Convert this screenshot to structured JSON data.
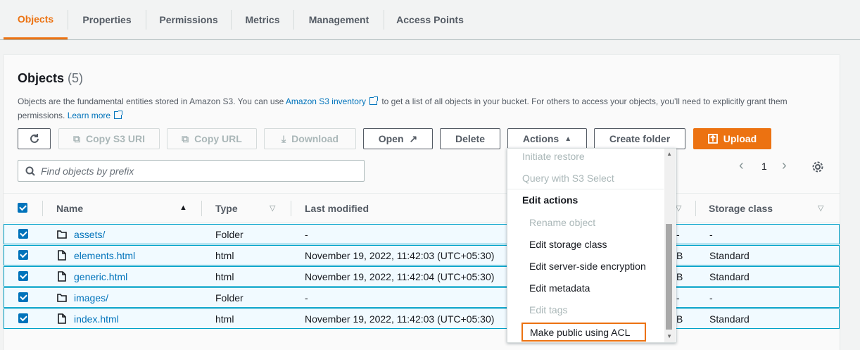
{
  "tabs": [
    "Objects",
    "Properties",
    "Permissions",
    "Metrics",
    "Management",
    "Access Points"
  ],
  "objects_panel": {
    "title": "Objects",
    "count": "(5)",
    "description_part1": "Objects are the fundamental entities stored in Amazon S3. You can use",
    "inventory_link": "Amazon S3 inventory",
    "description_part2": "to get a list of all objects in your bucket. For others to access your objects, you’ll need to explicitly grant them permissions.",
    "learn_more": "Learn more"
  },
  "toolbar": {
    "copy_s3_uri": "Copy S3 URI",
    "copy_url": "Copy URL",
    "download": "Download",
    "open": "Open",
    "delete": "Delete",
    "actions": "Actions",
    "create_folder": "Create folder",
    "upload": "Upload"
  },
  "search": {
    "placeholder": "Find objects by prefix"
  },
  "pagination": {
    "page": "1"
  },
  "table": {
    "headers": {
      "name": "Name",
      "type": "Type",
      "last_modified": "Last modified",
      "storage_class": "Storage class"
    },
    "rows": [
      {
        "name": "assets/",
        "type": "Folder",
        "last_modified": "-",
        "size": "-",
        "storage_class": "-",
        "kind": "folder"
      },
      {
        "name": "elements.html",
        "type": "html",
        "last_modified": "November 19, 2022, 11:42:03 (UTC+05:30)",
        "size": "B",
        "storage_class": "Standard",
        "kind": "file"
      },
      {
        "name": "generic.html",
        "type": "html",
        "last_modified": "November 19, 2022, 11:42:04 (UTC+05:30)",
        "size": "B",
        "storage_class": "Standard",
        "kind": "file"
      },
      {
        "name": "images/",
        "type": "Folder",
        "last_modified": "-",
        "size": "-",
        "storage_class": "-",
        "kind": "folder"
      },
      {
        "name": "index.html",
        "type": "html",
        "last_modified": "November 19, 2022, 11:42:03 (UTC+05:30)",
        "size": "B",
        "storage_class": "Standard",
        "kind": "file"
      }
    ]
  },
  "actions_menu": {
    "initiate_restore": "Initiate restore",
    "query_select": "Query with S3 Select",
    "edit_actions_heading": "Edit actions",
    "rename": "Rename object",
    "edit_storage_class": "Edit storage class",
    "edit_sse": "Edit server-side encryption",
    "edit_metadata": "Edit metadata",
    "edit_tags": "Edit tags",
    "make_public": "Make public using ACL"
  },
  "colors": {
    "accent": "#ec7211",
    "link": "#0073bb",
    "selected_row_bg": "#f1faff",
    "selected_row_border": "#00a1c9"
  }
}
